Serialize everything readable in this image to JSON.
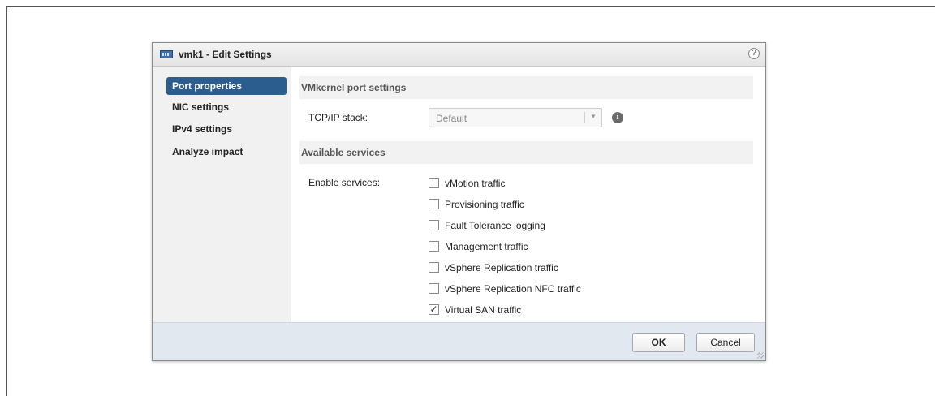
{
  "dialog": {
    "title": "vmk1 - Edit Settings",
    "help_symbol": "?"
  },
  "sidebar": {
    "items": [
      {
        "label": "Port properties",
        "active": true
      },
      {
        "label": "NIC settings",
        "active": false
      },
      {
        "label": "IPv4 settings",
        "active": false
      },
      {
        "label": "Analyze impact",
        "active": false
      }
    ]
  },
  "vmkernel_settings": {
    "header": "VMkernel port settings",
    "tcpip_label": "TCP/IP stack:",
    "tcpip_value": "Default",
    "info_symbol": "i"
  },
  "services": {
    "header": "Available services",
    "enable_label": "Enable services:",
    "items": [
      {
        "label": "vMotion traffic",
        "checked": false
      },
      {
        "label": "Provisioning traffic",
        "checked": false
      },
      {
        "label": "Fault Tolerance logging",
        "checked": false
      },
      {
        "label": "Management traffic",
        "checked": false
      },
      {
        "label": "vSphere Replication traffic",
        "checked": false
      },
      {
        "label": "vSphere Replication NFC traffic",
        "checked": false
      },
      {
        "label": "Virtual SAN traffic",
        "checked": true
      }
    ]
  },
  "footer": {
    "ok_label": "OK",
    "cancel_label": "Cancel"
  },
  "colors": {
    "nav_active": "#2b5d8e",
    "footer_bg": "#e2e8ef",
    "sidebar_bg": "#f1f1f1"
  }
}
